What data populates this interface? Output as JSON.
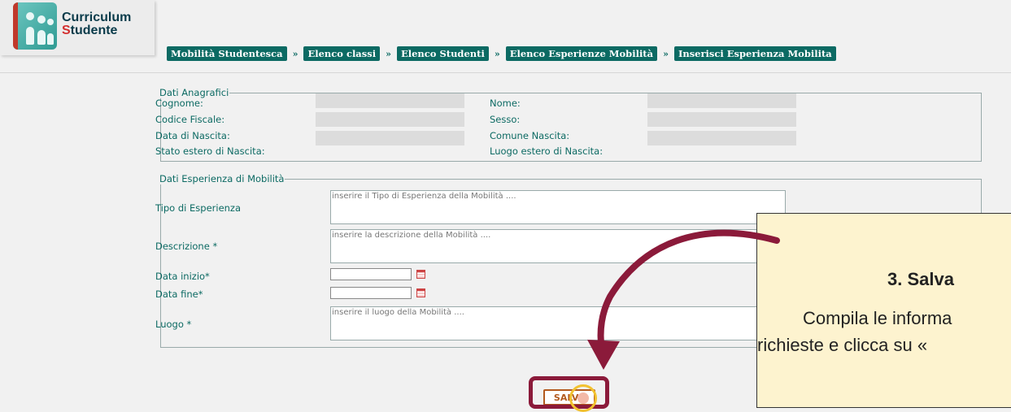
{
  "app": {
    "logo_line1": "Curriculum",
    "logo_line2_first": "S",
    "logo_line2_rest": "tudente"
  },
  "breadcrumb": [
    "Mobilità Studentesca",
    "Elenco classi",
    "Elenco Studenti",
    "Elenco Esperienze Mobilità",
    "Inserisci Esperienza Mobilita"
  ],
  "breadcrumb_separator": "»",
  "anagrafica": {
    "legend": "Dati Anagrafici",
    "cognome": "Cognome:",
    "nome": "Nome:",
    "codice_fiscale": "Codice Fiscale:",
    "sesso": "Sesso:",
    "data_nascita": "Data di Nascita:",
    "comune_nascita": "Comune Nascita:",
    "stato_estero": "Stato estero di Nascita:",
    "luogo_estero": "Luogo estero di Nascita:"
  },
  "mobilita": {
    "legend": "Dati Esperienza di Mobilità",
    "tipo_label": "Tipo di Esperienza",
    "tipo_placeholder": "inserire il Tipo di Esperienza della Mobilità ....",
    "descrizione_label": "Descrizione *",
    "descrizione_placeholder": "inserire la descrizione della Mobilità ....",
    "data_inizio_label": "Data inizio*",
    "data_fine_label": "Data fine*",
    "luogo_label": "Luogo *",
    "luogo_placeholder": "inserire il luogo della Mobilità ...."
  },
  "save_label": "SALVA",
  "callout": {
    "title": "3. Salva",
    "line1": "Compila le informa",
    "line2": "richieste e clicca su «"
  },
  "colors": {
    "accent": "#0c6a63",
    "highlight": "#8b1a3a",
    "callout_bg": "#fdf3cf",
    "save": "#b35a1f"
  }
}
